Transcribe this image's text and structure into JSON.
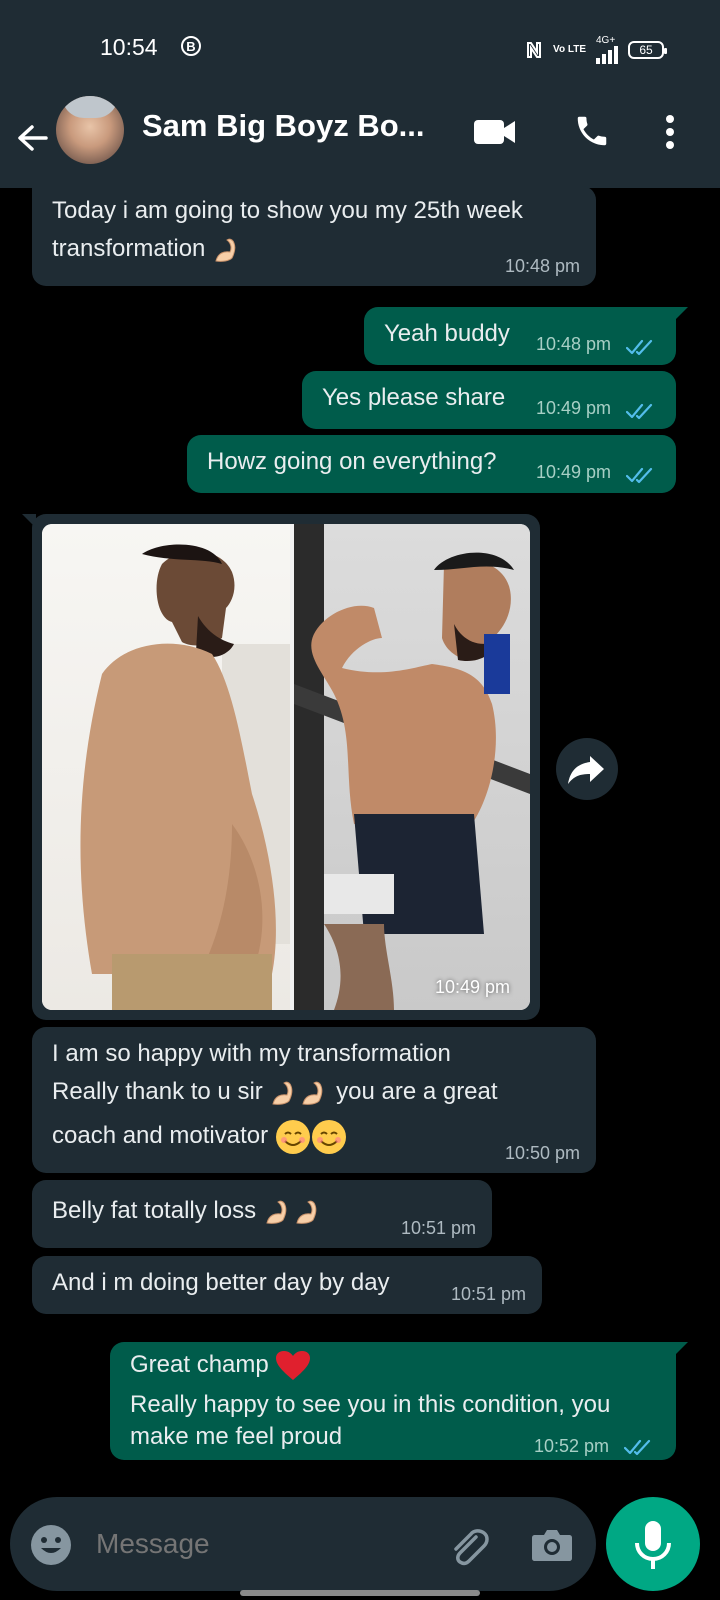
{
  "status_bar": {
    "time": "10:54",
    "battery": "65",
    "network": "4G+",
    "volte": "Vo LTE"
  },
  "header": {
    "title": "Sam Big Boyz Bo..."
  },
  "messages": [
    {
      "dir": "in",
      "lines": [
        "Today i am going to show you my 25th week",
        "transformation"
      ],
      "time": "10:48 pm"
    },
    {
      "dir": "out",
      "text": "Yeah buddy",
      "time": "10:48 pm"
    },
    {
      "dir": "out",
      "text": "Yes please share",
      "time": "10:49 pm"
    },
    {
      "dir": "out",
      "text": "Howz going on everything?",
      "time": "10:49 pm"
    },
    {
      "dir": "in",
      "type": "image",
      "time": "10:49 pm"
    },
    {
      "dir": "in",
      "lines": [
        "I am so happy with my transformation",
        "Really thank to u sir",
        "you are a great",
        "coach and motivator"
      ],
      "time": "10:50 pm"
    },
    {
      "dir": "in",
      "text": "Belly fat totally loss",
      "time": "10:51 pm"
    },
    {
      "dir": "in",
      "text": "And i m doing better day by day",
      "time": "10:51 pm"
    },
    {
      "dir": "out",
      "lines": [
        "Great champ",
        "Really happy to see you in this condition, you",
        "make me feel proud"
      ],
      "time": "10:52 pm"
    }
  ],
  "composer": {
    "placeholder": "Message"
  },
  "icons": [
    "back-arrow-icon",
    "video-call-icon",
    "phone-icon",
    "more-vert-icon",
    "forward-icon",
    "emoji-icon",
    "attach-icon",
    "camera-icon",
    "mic-icon"
  ],
  "colors": {
    "header": "#1f2c34",
    "incoming": "#1f2c34",
    "outgoing": "#005c4b",
    "accent": "#00a884",
    "read_ticks": "#53bdeb"
  }
}
